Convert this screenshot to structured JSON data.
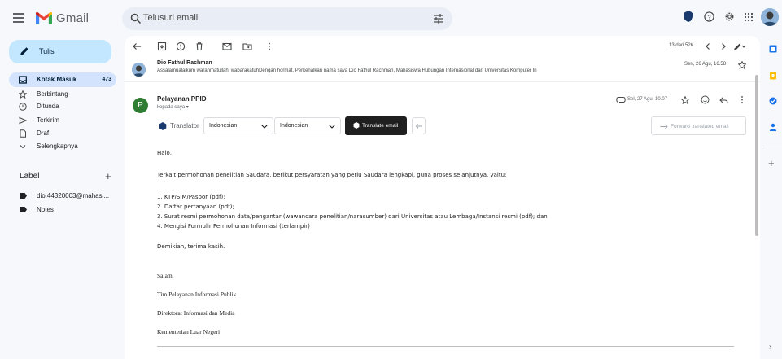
{
  "app": {
    "name": "Gmail"
  },
  "search": {
    "placeholder": "Telusuri email"
  },
  "sidebar": {
    "compose_label": "Tulis",
    "items": [
      {
        "label": "Kotak Masuk",
        "count": "473",
        "icon": "inbox-icon",
        "active": true
      },
      {
        "label": "Berbintang",
        "icon": "star-icon"
      },
      {
        "label": "Ditunda",
        "icon": "clock-icon"
      },
      {
        "label": "Terkirim",
        "icon": "send-icon"
      },
      {
        "label": "Draf",
        "icon": "draft-icon"
      },
      {
        "label": "Selengkapnya",
        "icon": "chevron-down-icon"
      }
    ],
    "labels_header": "Label",
    "labels": [
      {
        "label": "dio.44320003@mahasi..."
      },
      {
        "label": "Notes"
      }
    ]
  },
  "toolbar": {
    "pager": "13 dari 526"
  },
  "thread": {
    "prev": {
      "sender": "Dio Fathul Rachman",
      "snippet": "Assalamualaikum warahmatullahi wabarakatuhDengan hormat, Perkenalkan nama saya Dio Fathul Rachman, Mahasiswa Hubungan Internasional dari Universitas Komputer In",
      "date": "Sen, 26 Agu, 16.58"
    },
    "current": {
      "avatar_letter": "P",
      "sender": "Pelayanan PPID",
      "to": "kepada saya",
      "date": "Sel, 27 Agu, 10.07"
    }
  },
  "translator": {
    "title": "Translator",
    "from": "Indonesian",
    "to": "Indonesian",
    "translate_label": "Translate email",
    "forward_label": "Forward translated email"
  },
  "body": {
    "greeting": "Halo,",
    "intro": "Terkait permohonan penelitian Saudara, berikut persyaratan yang perlu Saudara lengkapi, guna proses selanjutnya, yaitu:",
    "items": [
      "1. KTP/SIM/Paspor (pdf);",
      "2. Daftar pertanyaan (pdf);",
      "3. Surat resmi permohonan data/pengantar (wawancara penelitian/narasumber) dari Universitas atau Lembaga/Instansi resmi (pdf); dan",
      "4. Mengisi Formulir Permohonan Informasi (terlampir)"
    ],
    "closing": "Demikian, terima kasih.",
    "salam": "Salam,",
    "sig1": "Tim Pelayanan Informasi Publik",
    "sig2": "Direktorat Informasi dan Media",
    "sig3": "Kementerian Luar Negeri"
  },
  "colors": {
    "accent": "#c2e7ff",
    "active_nav": "#d3e3fd",
    "avatar_green": "#2e7d32"
  }
}
